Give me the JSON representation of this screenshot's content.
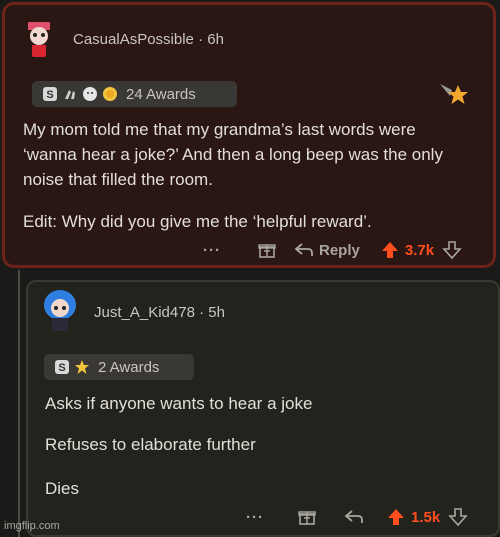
{
  "comments": [
    {
      "username": "CasualAsPossible",
      "time": "6h",
      "awards_label": "24 Awards",
      "body": [
        "My mom told me that my grandma’s last words were ‘wanna hear a joke?’ And then a long beep was the only noise that filled the room.",
        "Edit: Why did you give me the ‘helpful reward’."
      ],
      "reply_label": "Reply",
      "votes": "3.7k"
    },
    {
      "username": "Just_A_Kid478",
      "time": "5h",
      "awards_label": "2 Awards",
      "body": [
        "Asks if anyone wants to hear a joke",
        "Refuses to elaborate further",
        "Dies"
      ],
      "votes": "1.5k"
    }
  ],
  "separator": "·",
  "more_label": "···",
  "watermark": "imgflip.com",
  "colors": {
    "upvote": "#ff4d1e",
    "highlight_border": "#6e2219"
  }
}
